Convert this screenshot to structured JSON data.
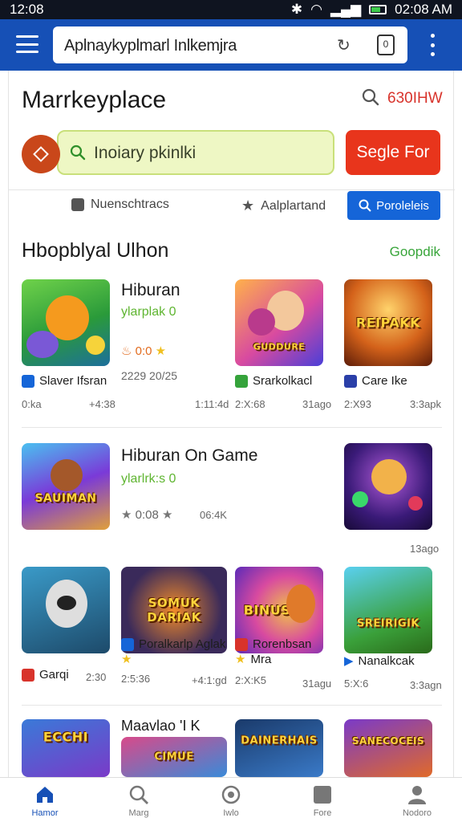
{
  "status_bar": {
    "time": "12:08",
    "right_time": "02:08 AM"
  },
  "browser": {
    "url": "Aplnaykyplmarl Inlkemjra",
    "tabs_count": "0"
  },
  "header": {
    "title": "Marrkeyplace",
    "search_label": "630IHW"
  },
  "search": {
    "placeholder": "Inoiary pkinlki",
    "button_label": "Segle For"
  },
  "filters": [
    {
      "label": "Nuenschtracs",
      "icon": "bag-icon"
    },
    {
      "label": "Aalplartand",
      "icon": "star-icon"
    },
    {
      "label": "Poroleleis",
      "icon": "search-icon",
      "active": true
    }
  ],
  "section": {
    "title": "Hbopblyal Ulhon",
    "link": "Goopdik"
  },
  "row1": {
    "feature": {
      "title": "Hiburan",
      "subtitle": "ylarplak 0",
      "rating": "0:0",
      "date": "2229 20/25"
    },
    "items": [
      {
        "label": "Slaver Ifsran",
        "meta_left": "0:ka",
        "meta_right": "+4:38",
        "icon_color": "#1565d8",
        "thumb_text": ""
      },
      {
        "label": "",
        "meta_left": "",
        "meta_right": "1:11:4d",
        "icon_color": "",
        "thumb_text": ""
      },
      {
        "label": "Srarkolkacl",
        "meta_left": "2:X:68",
        "meta_right": "31ago",
        "icon_color": "#35a33b",
        "thumb_text": "GUDDURE"
      },
      {
        "label": "Care Ike",
        "meta_left": "2:X93",
        "meta_right": "3:3apk",
        "icon_color": "#2a3fa8",
        "thumb_text": "REIPAKK"
      }
    ]
  },
  "row2": {
    "feature": {
      "title": "Hiburan On Game",
      "subtitle": "ylarlrk:s 0",
      "rating": "0:08",
      "meta": "06:4K"
    },
    "items": [
      {
        "thumb_text": "SAUIMAN"
      },
      {
        "thumb_text": "",
        "meta_right": "13ago"
      }
    ]
  },
  "row3": {
    "items": [
      {
        "label": "Garqi",
        "meta_left": "",
        "meta_right": "2:30",
        "icon_color": "#d8332b",
        "thumb_text": ""
      },
      {
        "label": "Poralkarlp Aglak",
        "meta_left": "2:5:36",
        "meta_right": "+4:1:gd",
        "icon_color": "#1565d8",
        "thumb_text": "SOMUK DARIAK",
        "star": true
      },
      {
        "label": "Rorenbsan",
        "sublabel": "Mra",
        "meta_left": "2:X:K5",
        "meta_right": "31agu",
        "icon_color": "#d8332b",
        "thumb_text": "BINUS"
      },
      {
        "label": "Nanalkcak",
        "meta_left": "5:X:6",
        "meta_right": "3:3agn",
        "icon_color": "#1565d8",
        "thumb_text": "SREIRIGIK"
      }
    ]
  },
  "row4": {
    "feature": {
      "title": "Maavlao 'I K"
    },
    "items": [
      {
        "thumb_text": "ECCHI"
      },
      {
        "thumb_text": "CIMUE"
      },
      {
        "thumb_text": "DAINERHAIS"
      },
      {
        "thumb_text": "SANECOCEIS"
      }
    ]
  },
  "bottom_nav": [
    {
      "label": "Hamor",
      "icon": "home-icon",
      "active": true
    },
    {
      "label": "Marg",
      "icon": "search-icon"
    },
    {
      "label": "Iwlo",
      "icon": "smile-icon"
    },
    {
      "label": "Fore",
      "icon": "square-icon"
    },
    {
      "label": "Nodoro",
      "icon": "person-icon"
    }
  ],
  "colors": {
    "app_bar": "#1650b6",
    "sign_button": "#e8351c",
    "search_field": "#eef7c4",
    "accent_blue": "#1565d8",
    "link_green": "#38a53a"
  }
}
